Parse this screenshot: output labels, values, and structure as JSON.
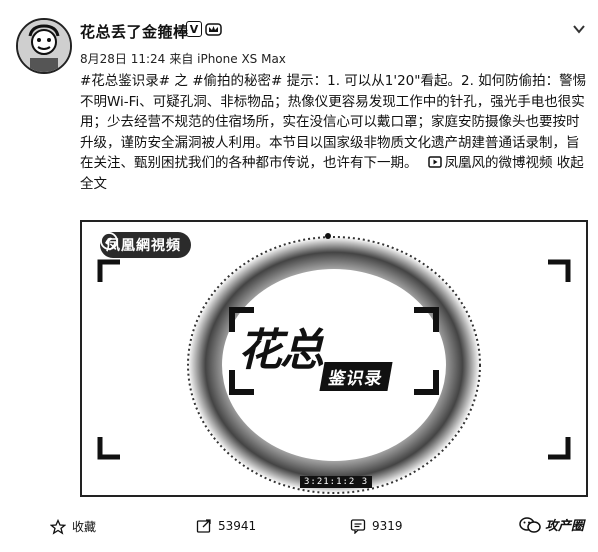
{
  "author": {
    "name": "花总丢了金箍棒",
    "badge_v": "V",
    "avatar_icon": "cartoon-avatar"
  },
  "meta": {
    "date": "8月28日 11:24",
    "source": "来自 iPhone XS Max"
  },
  "post": {
    "text": "#花总鉴识录# 之 #偷拍的秘密# 提示：1. 可以从1'20\"看起。2. 如何防偷拍：警惕不明Wi-Fi、可疑孔洞、非标物品；热像仪更容易发现工作中的针孔，强光手电也很实用；少去经营不规范的住宿场所，实在没信心可以戴口罩；家庭安防摄像头也要按时升级，谨防安全漏洞被人利用。本节目以国家级非物质文化遗产胡建普通话录制，旨在关注、甄别困扰我们的各种都市传说，也许有下一期。",
    "video_link": "凤凰风的微博视频",
    "collapse_label": "收起全文"
  },
  "video": {
    "logo_text": "凤凰網視頻",
    "title_big": "花总",
    "title_sub": "鉴识录",
    "timecode": "3:21:1:2 3"
  },
  "actions": {
    "favorite_label": "收藏",
    "repost_count": "53941",
    "comment_count": "9319"
  },
  "watermark": {
    "text": "攻产圈"
  }
}
